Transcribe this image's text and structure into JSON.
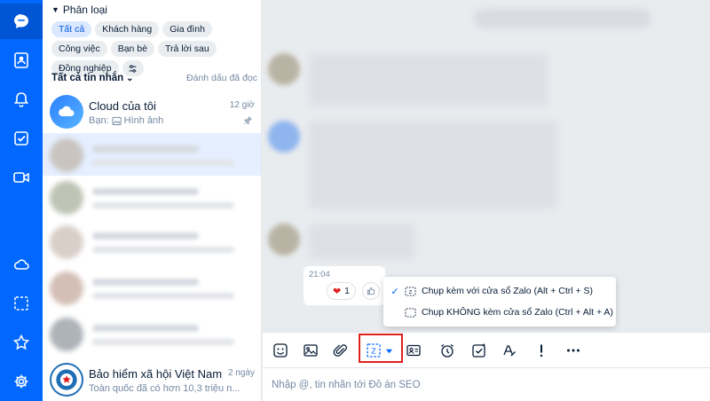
{
  "rail": {
    "icons": [
      "chat-icon",
      "contacts-icon",
      "bell-icon",
      "todo-icon",
      "video-icon",
      "cloud-icon",
      "screenshot-icon",
      "star-icon",
      "gear-icon"
    ],
    "accent": "#0068ff"
  },
  "categories": {
    "title": "Phân loại",
    "chips": [
      "Tất cả",
      "Khách hàng",
      "Gia đình",
      "Công việc",
      "Bạn bè",
      "Trả lời sau",
      "Đồng nghiệp"
    ],
    "active_chip": "Tất cả"
  },
  "filter": {
    "label": "Tất cả tin nhắn",
    "mark_read": "Đánh dấu đã đọc"
  },
  "conversations": {
    "cloud": {
      "name": "Cloud của tôi",
      "time": "12 giờ",
      "preview_prefix": "Bạn:",
      "preview_text": "Hình ảnh"
    },
    "bhxh": {
      "name": "Bảo hiểm xã hội Việt Nam",
      "time": "2 ngày",
      "preview": "Toàn quốc đã có hơn 10,3 triệu n..."
    }
  },
  "message": {
    "time": "21:04",
    "reaction_count": "1"
  },
  "capture_menu": {
    "item_with_window": "Chụp kèm với cửa sổ Zalo (Alt + Ctrl + S)",
    "item_without_window": "Chụp KHÔNG kèm cửa sổ Zalo (Ctrl + Alt + A)",
    "checked_item": "item_with_window"
  },
  "toolbar": {
    "tools": [
      "sticker-icon",
      "image-icon",
      "attach-icon",
      "screenshot-capture-icon",
      "contact-card-icon",
      "alarm-icon",
      "task-icon",
      "format-icon",
      "urgent-icon",
      "more-icon"
    ]
  },
  "composer": {
    "placeholder": "Nhập @, tin nhắn tới Đồ án SEO"
  }
}
